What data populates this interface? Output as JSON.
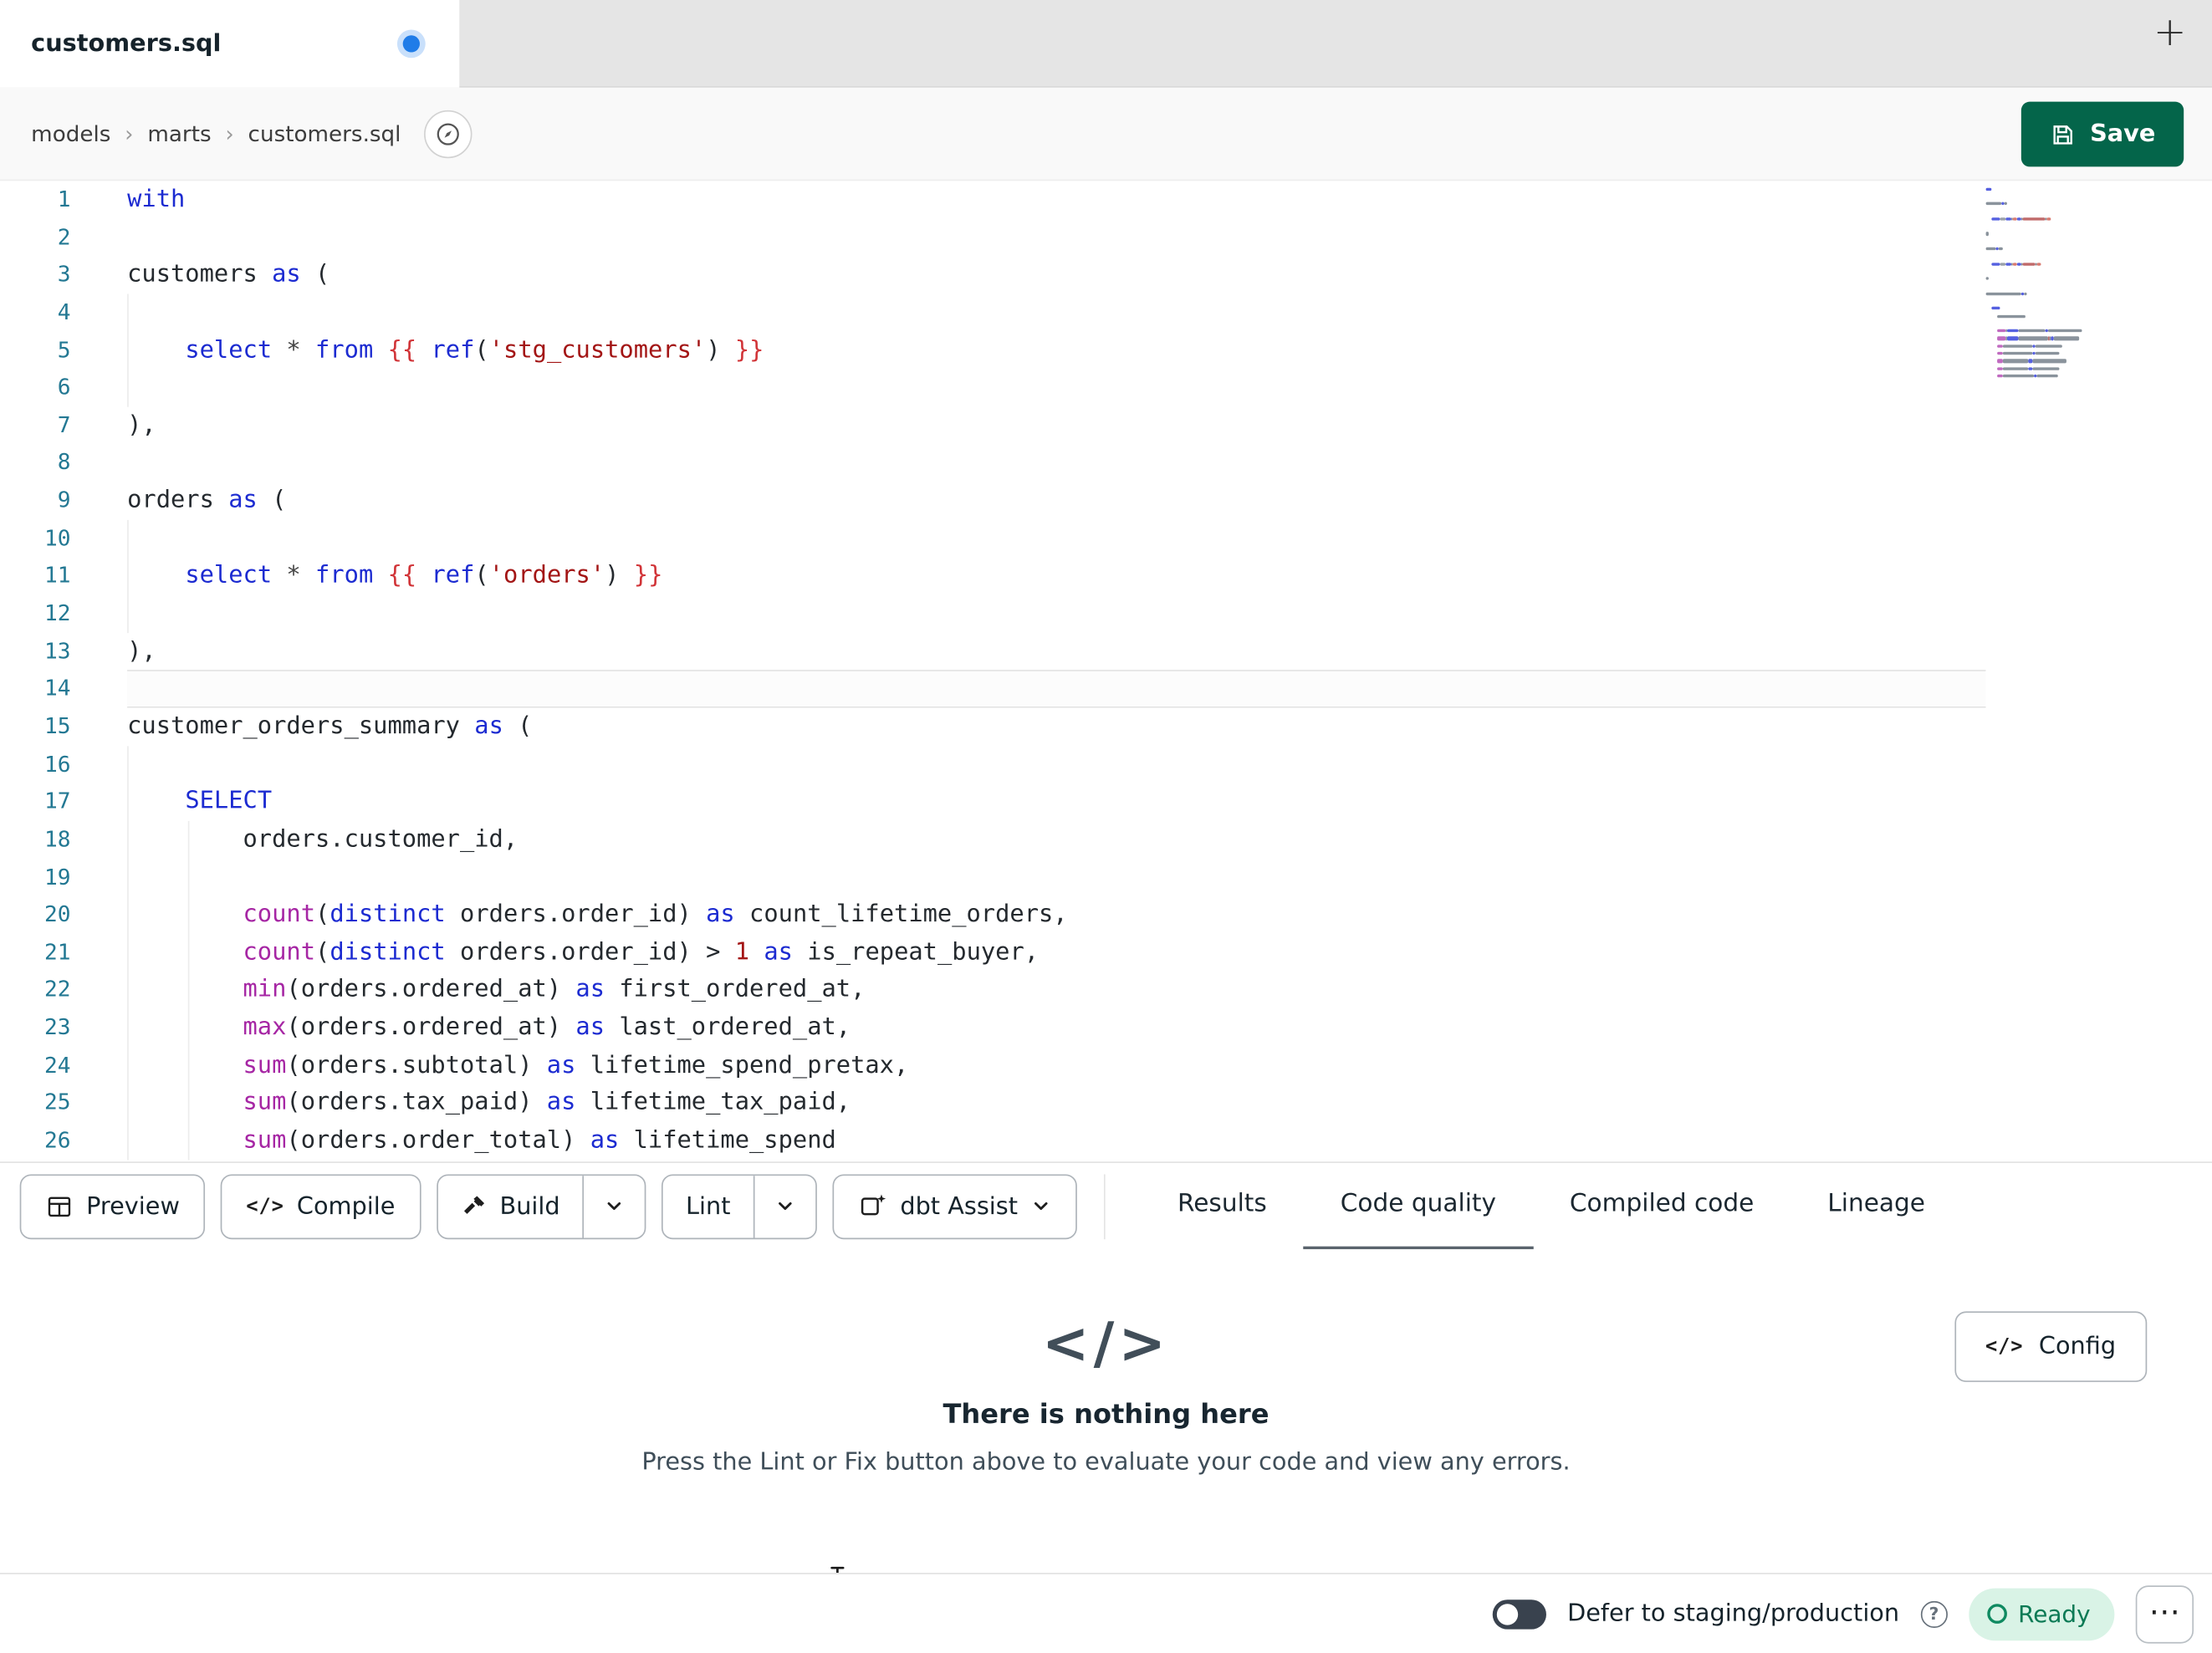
{
  "colors": {
    "keyword": "#1c2bd1",
    "function": "#a626a4",
    "string": "#a31515",
    "jinja": "#d13438",
    "number": "#a31515",
    "operator": "#444444",
    "plain": "#24292e",
    "line_number": "#237893",
    "save_button_bg": "#04654a",
    "dirty_dot": "#1f7ce8",
    "ready_bg": "#d9f3e6",
    "ready_text": "#0b7a55"
  },
  "minimap_colors": {
    "pl": "#8a939c",
    "kw": "#5560e0",
    "fn": "#c06ac0",
    "str": "#c06a6a",
    "jinja": "#d87a70",
    "num": "#c06a6a",
    "op": "#9aa1a8"
  },
  "tab_bar": {
    "active_tab": "customers.sql",
    "new_tab_label": "+"
  },
  "breadcrumb": {
    "items": [
      "models",
      "marts",
      "customers.sql"
    ],
    "separator": "›"
  },
  "save_button": {
    "label": "Save"
  },
  "editor": {
    "current_line": 14,
    "lines": [
      {
        "n": 1,
        "tokens": [
          [
            "kw",
            "with"
          ]
        ]
      },
      {
        "n": 2,
        "tokens": []
      },
      {
        "n": 3,
        "tokens": [
          [
            "pl",
            "customers "
          ],
          [
            "kw",
            "as"
          ],
          [
            "pl",
            " ("
          ]
        ]
      },
      {
        "n": 4,
        "tokens": []
      },
      {
        "n": 5,
        "tokens": [
          [
            "pl",
            "    "
          ],
          [
            "kw",
            "select"
          ],
          [
            "op",
            " * "
          ],
          [
            "kw",
            "from"
          ],
          [
            "pl",
            " "
          ],
          [
            "jinja",
            "{{ "
          ],
          [
            "kw",
            "ref"
          ],
          [
            "pl",
            "("
          ],
          [
            "str",
            "'stg_customers'"
          ],
          [
            "pl",
            ")"
          ],
          [
            "jinja",
            " }}"
          ]
        ]
      },
      {
        "n": 6,
        "tokens": []
      },
      {
        "n": 7,
        "tokens": [
          [
            "pl",
            "),"
          ]
        ]
      },
      {
        "n": 8,
        "tokens": []
      },
      {
        "n": 9,
        "tokens": [
          [
            "pl",
            "orders "
          ],
          [
            "kw",
            "as"
          ],
          [
            "pl",
            " ("
          ]
        ]
      },
      {
        "n": 10,
        "tokens": []
      },
      {
        "n": 11,
        "tokens": [
          [
            "pl",
            "    "
          ],
          [
            "kw",
            "select"
          ],
          [
            "op",
            " * "
          ],
          [
            "kw",
            "from"
          ],
          [
            "pl",
            " "
          ],
          [
            "jinja",
            "{{ "
          ],
          [
            "kw",
            "ref"
          ],
          [
            "pl",
            "("
          ],
          [
            "str",
            "'orders'"
          ],
          [
            "pl",
            ")"
          ],
          [
            "jinja",
            " }}"
          ]
        ]
      },
      {
        "n": 12,
        "tokens": []
      },
      {
        "n": 13,
        "tokens": [
          [
            "pl",
            "),"
          ]
        ]
      },
      {
        "n": 14,
        "tokens": []
      },
      {
        "n": 15,
        "tokens": [
          [
            "pl",
            "customer_orders_summary "
          ],
          [
            "kw",
            "as"
          ],
          [
            "pl",
            " ("
          ]
        ]
      },
      {
        "n": 16,
        "tokens": []
      },
      {
        "n": 17,
        "tokens": [
          [
            "pl",
            "    "
          ],
          [
            "kw",
            "SELECT"
          ]
        ]
      },
      {
        "n": 18,
        "tokens": [
          [
            "pl",
            "        orders.customer_id,"
          ]
        ]
      },
      {
        "n": 19,
        "tokens": []
      },
      {
        "n": 20,
        "tokens": [
          [
            "pl",
            "        "
          ],
          [
            "fn",
            "count"
          ],
          [
            "pl",
            "("
          ],
          [
            "kw",
            "distinct"
          ],
          [
            "pl",
            " orders.order_id) "
          ],
          [
            "kw",
            "as"
          ],
          [
            "pl",
            " count_lifetime_orders,"
          ]
        ]
      },
      {
        "n": 21,
        "tokens": [
          [
            "pl",
            "        "
          ],
          [
            "fn",
            "count"
          ],
          [
            "pl",
            "("
          ],
          [
            "kw",
            "distinct"
          ],
          [
            "pl",
            " orders.order_id) > "
          ],
          [
            "num",
            "1"
          ],
          [
            "pl",
            " "
          ],
          [
            "kw",
            "as"
          ],
          [
            "pl",
            " is_repeat_buyer,"
          ]
        ]
      },
      {
        "n": 22,
        "tokens": [
          [
            "pl",
            "        "
          ],
          [
            "fn",
            "min"
          ],
          [
            "pl",
            "(orders.ordered_at) "
          ],
          [
            "kw",
            "as"
          ],
          [
            "pl",
            " first_ordered_at,"
          ]
        ]
      },
      {
        "n": 23,
        "tokens": [
          [
            "pl",
            "        "
          ],
          [
            "fn",
            "max"
          ],
          [
            "pl",
            "(orders.ordered_at) "
          ],
          [
            "kw",
            "as"
          ],
          [
            "pl",
            " last_ordered_at,"
          ]
        ]
      },
      {
        "n": 24,
        "tokens": [
          [
            "pl",
            "        "
          ],
          [
            "fn",
            "sum"
          ],
          [
            "pl",
            "(orders.subtotal) "
          ],
          [
            "kw",
            "as"
          ],
          [
            "pl",
            " lifetime_spend_pretax,"
          ]
        ]
      },
      {
        "n": 25,
        "tokens": [
          [
            "pl",
            "        "
          ],
          [
            "fn",
            "sum"
          ],
          [
            "pl",
            "(orders.tax_paid) "
          ],
          [
            "kw",
            "as"
          ],
          [
            "pl",
            " lifetime_tax_paid,"
          ]
        ]
      },
      {
        "n": 26,
        "tokens": [
          [
            "pl",
            "        "
          ],
          [
            "fn",
            "sum"
          ],
          [
            "pl",
            "(orders.order_total) "
          ],
          [
            "kw",
            "as"
          ],
          [
            "pl",
            " lifetime_spend"
          ]
        ]
      }
    ]
  },
  "toolbar": {
    "preview_label": "Preview",
    "compile_label": "Compile",
    "build_label": "Build",
    "lint_label": "Lint",
    "assist_label": "dbt Assist",
    "code_icon_glyph": "</>"
  },
  "panel_tabs": [
    {
      "label": "Results",
      "active": false
    },
    {
      "label": "Code quality",
      "active": true
    },
    {
      "label": "Compiled code",
      "active": false
    },
    {
      "label": "Lineage",
      "active": false
    }
  ],
  "results_panel": {
    "icon_glyph": "</>",
    "title": "There is nothing here",
    "subtitle": "Press the Lint or Fix button above to evaluate your code and view any errors.",
    "config_label": "Config"
  },
  "status_bar": {
    "toggle_on": false,
    "defer_label": "Defer to staging/production",
    "help_glyph": "?",
    "ready_label": "Ready",
    "ellipsis_glyph": "⋯"
  }
}
